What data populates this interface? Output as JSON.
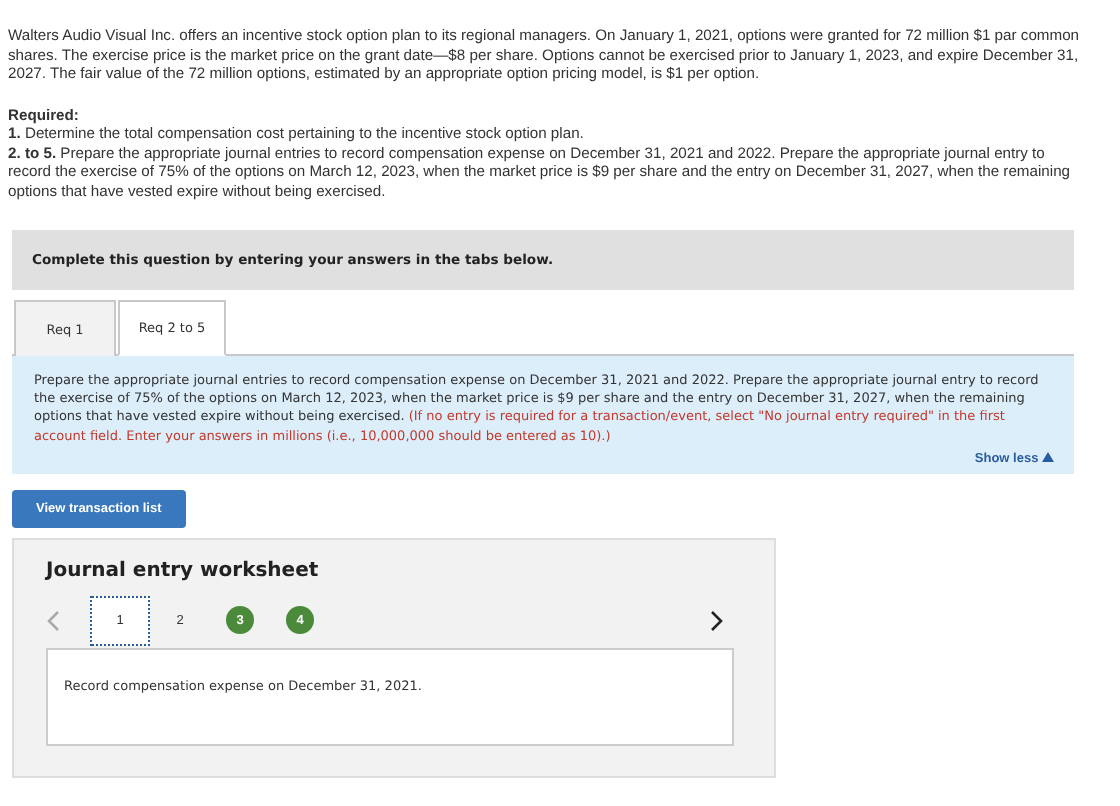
{
  "intro": "Walters Audio Visual Inc. offers an incentive stock option plan to its regional managers. On January 1, 2021, options were granted for 72 million $1 par common shares. The exercise price is the market price on the grant date—$8 per share. Options cannot be exercised prior to January 1, 2023, and expire December 31, 2027. The fair value of the 72 million options, estimated by an appropriate option pricing model, is $1 per option.",
  "required": {
    "heading": "Required:",
    "items": [
      "**1.** Determine the total compensation cost pertaining to the incentive stock option plan.",
      "**2. to 5.** Prepare the appropriate journal entries to record compensation expense on December 31, 2021 and 2022. Prepare the appropriate journal entry to record the exercise of 75% of the options on March 12, 2023, when the market price is $9 per share and the entry on December 31, 2027, when the remaining options that have vested expire without being exercised."
    ]
  },
  "banner": "Complete this question by entering your answers in the tabs below.",
  "tabs": [
    {
      "label": "Req 1",
      "selected": false
    },
    {
      "label": "Req 2 to 5",
      "selected": true
    }
  ],
  "instructions": {
    "text": "Prepare the appropriate journal entries to record compensation expense on December 31, 2021 and 2022. Prepare the appropriate journal entry to record the exercise of 75% of the options on March 12, 2023, when the market price is $9 per share and the entry on December 31, 2027, when the remaining options that have vested expire without being exercised.",
    "note": "(If no entry is required for a transaction/event, select \"No journal entry required\" in the first account field. Enter your answers in millions (i.e., 10,000,000 should be entered as 10).)",
    "toggle": "Show less"
  },
  "view_button": "View transaction list",
  "worksheet": {
    "title": "Journal entry worksheet",
    "prev_disabled": true,
    "next_disabled": false,
    "pages": [
      {
        "label": "1",
        "selected": true,
        "completed": false
      },
      {
        "label": "2",
        "selected": false,
        "completed": false
      },
      {
        "label": "3",
        "selected": false,
        "completed": true
      },
      {
        "label": "4",
        "selected": false,
        "completed": true
      }
    ],
    "description": "Record compensation expense on December 31, 2021."
  }
}
